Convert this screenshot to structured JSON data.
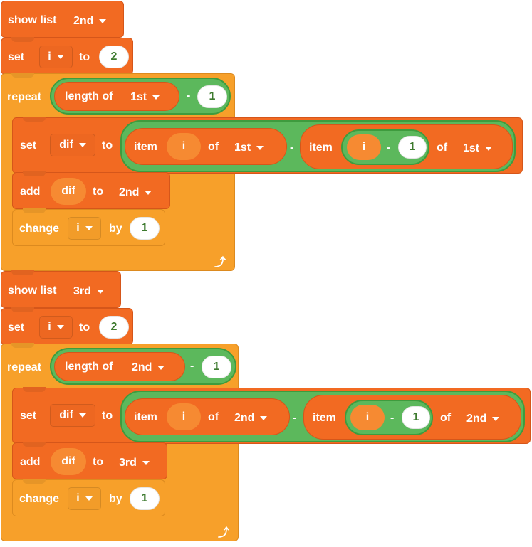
{
  "colors": {
    "list_block": "#f26a22",
    "control_block": "#f7a02a",
    "operator": "#5cb85c",
    "number_text": "#3d7a2e"
  },
  "scripts": [
    {
      "show_list": {
        "label": "show list",
        "list": "2nd"
      },
      "set": {
        "label": "set",
        "var": "i",
        "to": "to",
        "value": "2"
      },
      "repeat": {
        "label": "repeat",
        "length_of": "length of",
        "list": "1st",
        "minus": "-",
        "value": "1"
      },
      "inner_set": {
        "label": "set",
        "var": "dif",
        "to": "to",
        "left": {
          "item": "item",
          "index": "i",
          "of": "of",
          "list": "1st"
        },
        "minus": "-",
        "right": {
          "item": "item",
          "index": "i",
          "minus": "-",
          "num": "1",
          "of": "of",
          "list": "1st"
        }
      },
      "add": {
        "label": "add",
        "value": "dif",
        "to": "to",
        "list": "2nd"
      },
      "change": {
        "label": "change",
        "var": "i",
        "by": "by",
        "value": "1"
      },
      "loop_icon": "loop-arrow-icon"
    },
    {
      "show_list": {
        "label": "show list",
        "list": "3rd"
      },
      "set": {
        "label": "set",
        "var": "i",
        "to": "to",
        "value": "2"
      },
      "repeat": {
        "label": "repeat",
        "length_of": "length of",
        "list": "2nd",
        "minus": "-",
        "value": "1"
      },
      "inner_set": {
        "label": "set",
        "var": "dif",
        "to": "to",
        "left": {
          "item": "item",
          "index": "i",
          "of": "of",
          "list": "2nd"
        },
        "minus": "-",
        "right": {
          "item": "item",
          "index": "i",
          "minus": "-",
          "num": "1",
          "of": "of",
          "list": "2nd"
        }
      },
      "add": {
        "label": "add",
        "value": "dif",
        "to": "to",
        "list": "3rd"
      },
      "change": {
        "label": "change",
        "var": "i",
        "by": "by",
        "value": "1"
      },
      "loop_icon": "loop-arrow-icon"
    }
  ]
}
